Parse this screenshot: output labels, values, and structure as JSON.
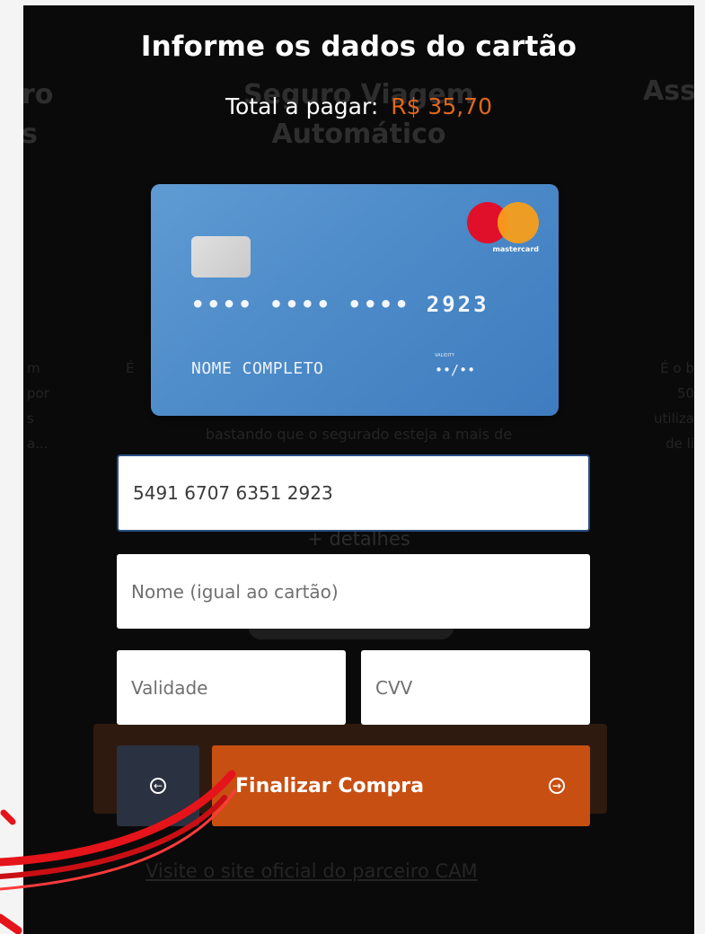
{
  "background_page": {
    "left_title_lines": [
      "ro",
      "s"
    ],
    "center_title_lines": [
      "Seguro Viagem",
      "Automático"
    ],
    "right_title": "Ass",
    "left_text_lines": [
      "m",
      "por",
      "s",
      "a..."
    ],
    "center_text_line": "bastando que o segurado esteja a mais de",
    "center_text_prefix": "É",
    "details_link": "+ detalhes",
    "right_text_lines": [
      "É o b",
      "50",
      "utiliza",
      "de li"
    ],
    "partner_link": "Visite o site oficial do parceiro CAM"
  },
  "modal": {
    "title": "Informe os dados do cartão",
    "total_label": "Total a pagar:",
    "total_amount": "R$ 35,70"
  },
  "card_preview": {
    "number": "•••• •••• •••• 2923",
    "name": "NOME COMPLETO",
    "expiry_label": "VALIDITY",
    "expiry": "••/••",
    "brand": "mastercard",
    "brand_icon": "mastercard-logo",
    "color": "#4d8bc9"
  },
  "form": {
    "card_number_value": "5491 6707 6351 2923",
    "name_placeholder": "Nome (igual ao cartão)",
    "expiry_placeholder": "Validade",
    "cvv_placeholder": "CVV"
  },
  "buttons": {
    "back_icon": "circle-arrow-left-icon",
    "back_glyph": "←",
    "finish_label": "Finalizar Compra",
    "finish_icon": "circle-arrow-right-icon",
    "finish_glyph": "→",
    "finish_color": "#c84f12"
  }
}
